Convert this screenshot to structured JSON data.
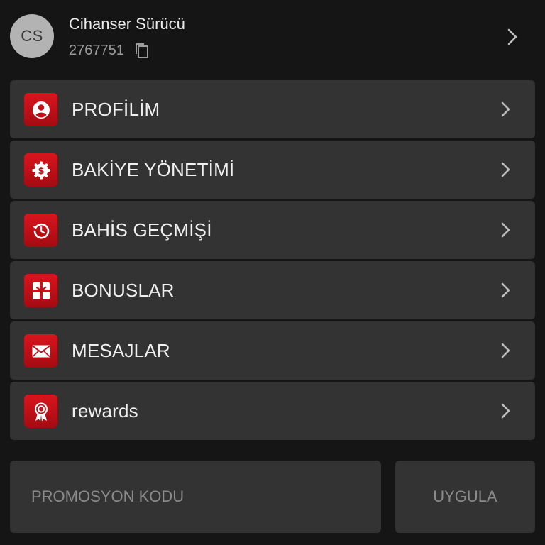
{
  "user": {
    "initials": "CS",
    "name": "Cihanser Sürücü",
    "id": "2767751"
  },
  "menu": {
    "items": [
      {
        "label": "PROFİLİM",
        "icon": "profile-icon"
      },
      {
        "label": "BAKİYE YÖNETİMİ",
        "icon": "balance-gear-dollar-icon"
      },
      {
        "label": "BAHİS GEÇMİŞİ",
        "icon": "history-icon"
      },
      {
        "label": "BONUSLAR",
        "icon": "bonus-gift-icon"
      },
      {
        "label": "MESAJLAR",
        "icon": "envelope-icon"
      },
      {
        "label": "rewards",
        "icon": "award-ribbon-icon"
      }
    ]
  },
  "promo": {
    "placeholder": "PROMOSYON KODU",
    "value": "",
    "apply_label": "UYGULA"
  },
  "colors": {
    "background": "#151516",
    "card": "#333334",
    "accent_red": "#d9151d",
    "text_primary": "#f0f0f0",
    "text_muted": "#9c9c9c"
  }
}
